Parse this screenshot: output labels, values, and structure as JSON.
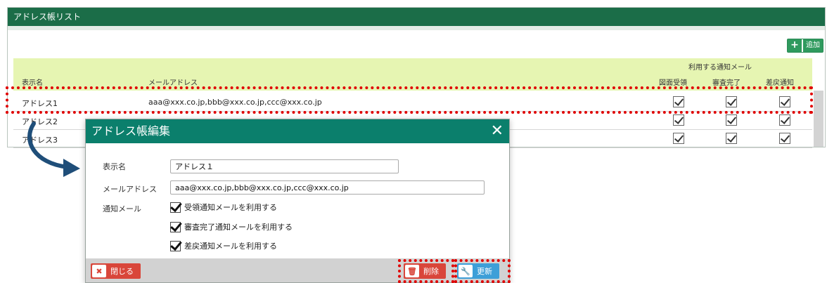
{
  "panel": {
    "title": "アドレス帳リスト",
    "add_label": "追加",
    "add_icon": "plus-icon"
  },
  "table": {
    "group_header": "利用する通知メール",
    "columns": [
      "表示名",
      "メールアドレス",
      "図面受領",
      "審査完了",
      "差戻通知"
    ],
    "rows": [
      {
        "name": "アドレス1",
        "email": "aaa@xxx.co.jp,bbb@xxx.co.jp,ccc@xxx.co.jp",
        "checks": [
          true,
          true,
          true
        ]
      },
      {
        "name": "アドレス2",
        "email": "",
        "checks": [
          true,
          true,
          true
        ]
      },
      {
        "name": "アドレス3",
        "email": "",
        "checks": [
          true,
          true,
          true
        ]
      }
    ]
  },
  "dialog": {
    "title": "アドレス帳編集",
    "close_icon": "close-icon",
    "display_name_label": "表示名",
    "display_name_value": "アドレス１",
    "email_label": "メールアドレス",
    "email_value": "aaa@xxx.co.jp,bbb@xxx.co.jp,ccc@xxx.co.jp",
    "notify_label": "通知メール",
    "options": [
      "受領通知メールを利用する",
      "審査完了通知メールを利用する",
      "差戻通知メールを利用する"
    ],
    "close_button": "閉じる",
    "delete_button": "削除",
    "update_button": "更新"
  },
  "colors": {
    "header_green": "#1b6d48",
    "dialog_title": "#0b7f6c",
    "table_header": "#e6f5b2",
    "highlight": "#e00000",
    "danger": "#d9463a",
    "primary": "#3d9fd8",
    "arrow": "#1f4e79"
  }
}
